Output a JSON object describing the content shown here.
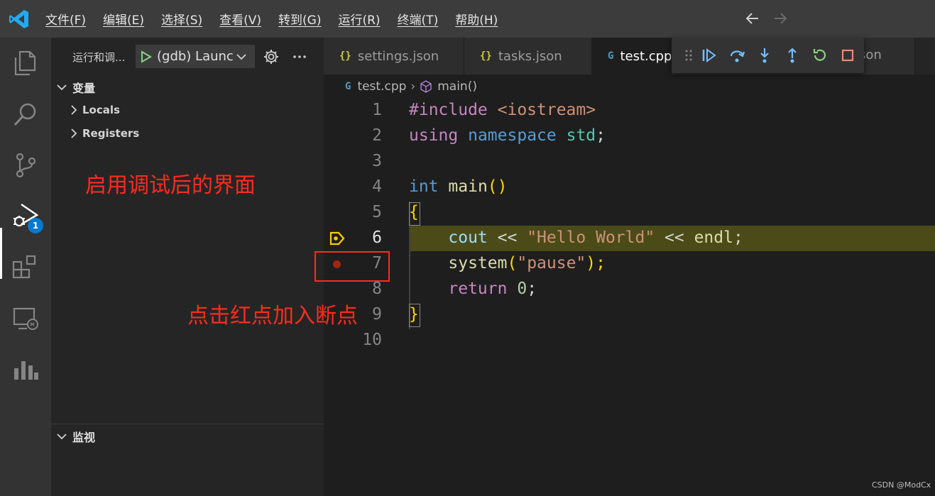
{
  "menu": {
    "items": [
      "文件(F)",
      "编辑(E)",
      "选择(S)",
      "查看(V)",
      "转到(G)",
      "运行(R)",
      "终端(T)",
      "帮助(H)"
    ]
  },
  "activity_bar": {
    "icons": [
      "explorer-icon",
      "search-icon",
      "source-control-icon",
      "run-debug-icon",
      "extensions-icon",
      "remote-explorer-icon",
      "chart-icon"
    ],
    "debug_badge": "1"
  },
  "sidebar": {
    "title": "运行和调...",
    "launch_config": "(gdb) Launch",
    "variables_header": "变量",
    "tree": [
      "Locals",
      "Registers"
    ],
    "watch_header": "监视"
  },
  "annotations": {
    "debug_ui": "启用调试后的界面",
    "breakpoint": "点击红点加入断点"
  },
  "tabs": {
    "settings": "settings.json",
    "tasks": "tasks.json",
    "test": "test.cpp",
    "hidden_suffix": "son",
    "json_icon": "{}",
    "cpp_icon": "G"
  },
  "breadcrumb": {
    "file": "test.cpp",
    "symbol": "main()"
  },
  "editor": {
    "line_numbers": [
      "1",
      "2",
      "3",
      "4",
      "5",
      "6",
      "7",
      "8",
      "9",
      "10"
    ],
    "current_line": "6",
    "breakpoint_line": "7",
    "lines": {
      "l1": [
        "#include",
        " <iostream>"
      ],
      "l2": [
        "using",
        " ",
        "namespace",
        " ",
        "std",
        ";"
      ],
      "l4": [
        "int",
        " ",
        "main",
        "()"
      ],
      "l5": [
        "{"
      ],
      "l6": [
        "    ",
        "cout",
        " << ",
        "\"Hello World\"",
        " << ",
        "endl",
        ";"
      ],
      "l7": [
        "    ",
        "system",
        "(",
        "\"pause\"",
        ");"
      ],
      "l8": [
        "    ",
        "return",
        " ",
        "0",
        ";"
      ],
      "l9": [
        "}"
      ]
    }
  },
  "watermark": "CSDN @ModCx",
  "colors": {
    "accent": "#007acc",
    "annotation_red": "#ff2b1c",
    "current_line_bg": "#4b4b18",
    "breakpoint": "#a1260d"
  }
}
